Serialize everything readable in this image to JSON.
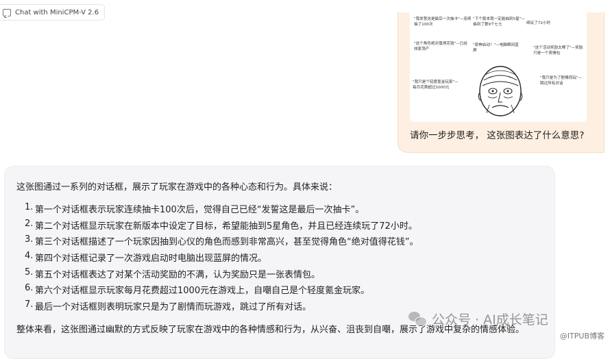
{
  "app": {
    "tab_title": "Chat with MiniCPM-V 2.6"
  },
  "user_message": {
    "meme_captions": [
      "\"我发誓这是最后一次抽卡\"—连续抽了100次",
      "\"下个版本我一定能抽到5星\"—抽到了第9个七七",
      "续玩了72小时",
      "\"这个角色绝对值得花钱\"—已经倾家荡产",
      "\"原神启动！\"—电脑瞬间蓝屏",
      "\"这个活动奖励太棒了\"—奖励只是一个表情包",
      "\"我只是个轻度氪金玩家\"—每月花费超过1000元",
      "\"我只是为了剧情而玩\"—跳过所有对话"
    ],
    "question": "请你一步步思考， 这张图表达了什么意思?"
  },
  "assistant_message": {
    "intro": "这张图通过一系列的对话框，展示了玩家在游戏中的各种心态和行为。具体来说：",
    "steps": [
      {
        "num": "1.",
        "text": "第一个对话框表示玩家连续抽卡100次后，觉得自己已经“发誓这是最后一次抽卡”。"
      },
      {
        "num": "2.",
        "text": "第二个对话框显示玩家在新版本中设定了目标，希望能抽到5星角色，并且已经连续玩了72小时。"
      },
      {
        "num": "3.",
        "text": "第三个对话框描述了一个玩家因抽到心仪的角色而感到非常高兴，甚至觉得角色“绝对值得花钱”。"
      },
      {
        "num": "4.",
        "text": "第四个对话框记录了一次游戏启动时电脑出现蓝屏的情况。"
      },
      {
        "num": "5.",
        "text": "第五个对话框表达了对某个活动奖励的不满，认为奖励只是一张表情包。"
      },
      {
        "num": "6.",
        "text": "第六个对话框显示玩家每月花费超过1000元在游戏上，自嘲自己是个轻度氪金玩家。"
      },
      {
        "num": "7.",
        "text": "最后一个对话框则表明玩家只是为了剧情而玩游戏，跳过了所有对话。"
      }
    ],
    "summary": "整体来看，这张图通过幽默的方式反映了玩家在游戏中的各种情感和行为，从兴奋、沮丧到自嘲，展示了游戏中复杂的情感体验。"
  },
  "watermarks": {
    "wechat": "公众号 · AI成长笔记",
    "site": "@ITPUB博客"
  },
  "colors": {
    "user_bubble": "#fdf0e2",
    "assistant_bubble": "#f5f5f7"
  }
}
